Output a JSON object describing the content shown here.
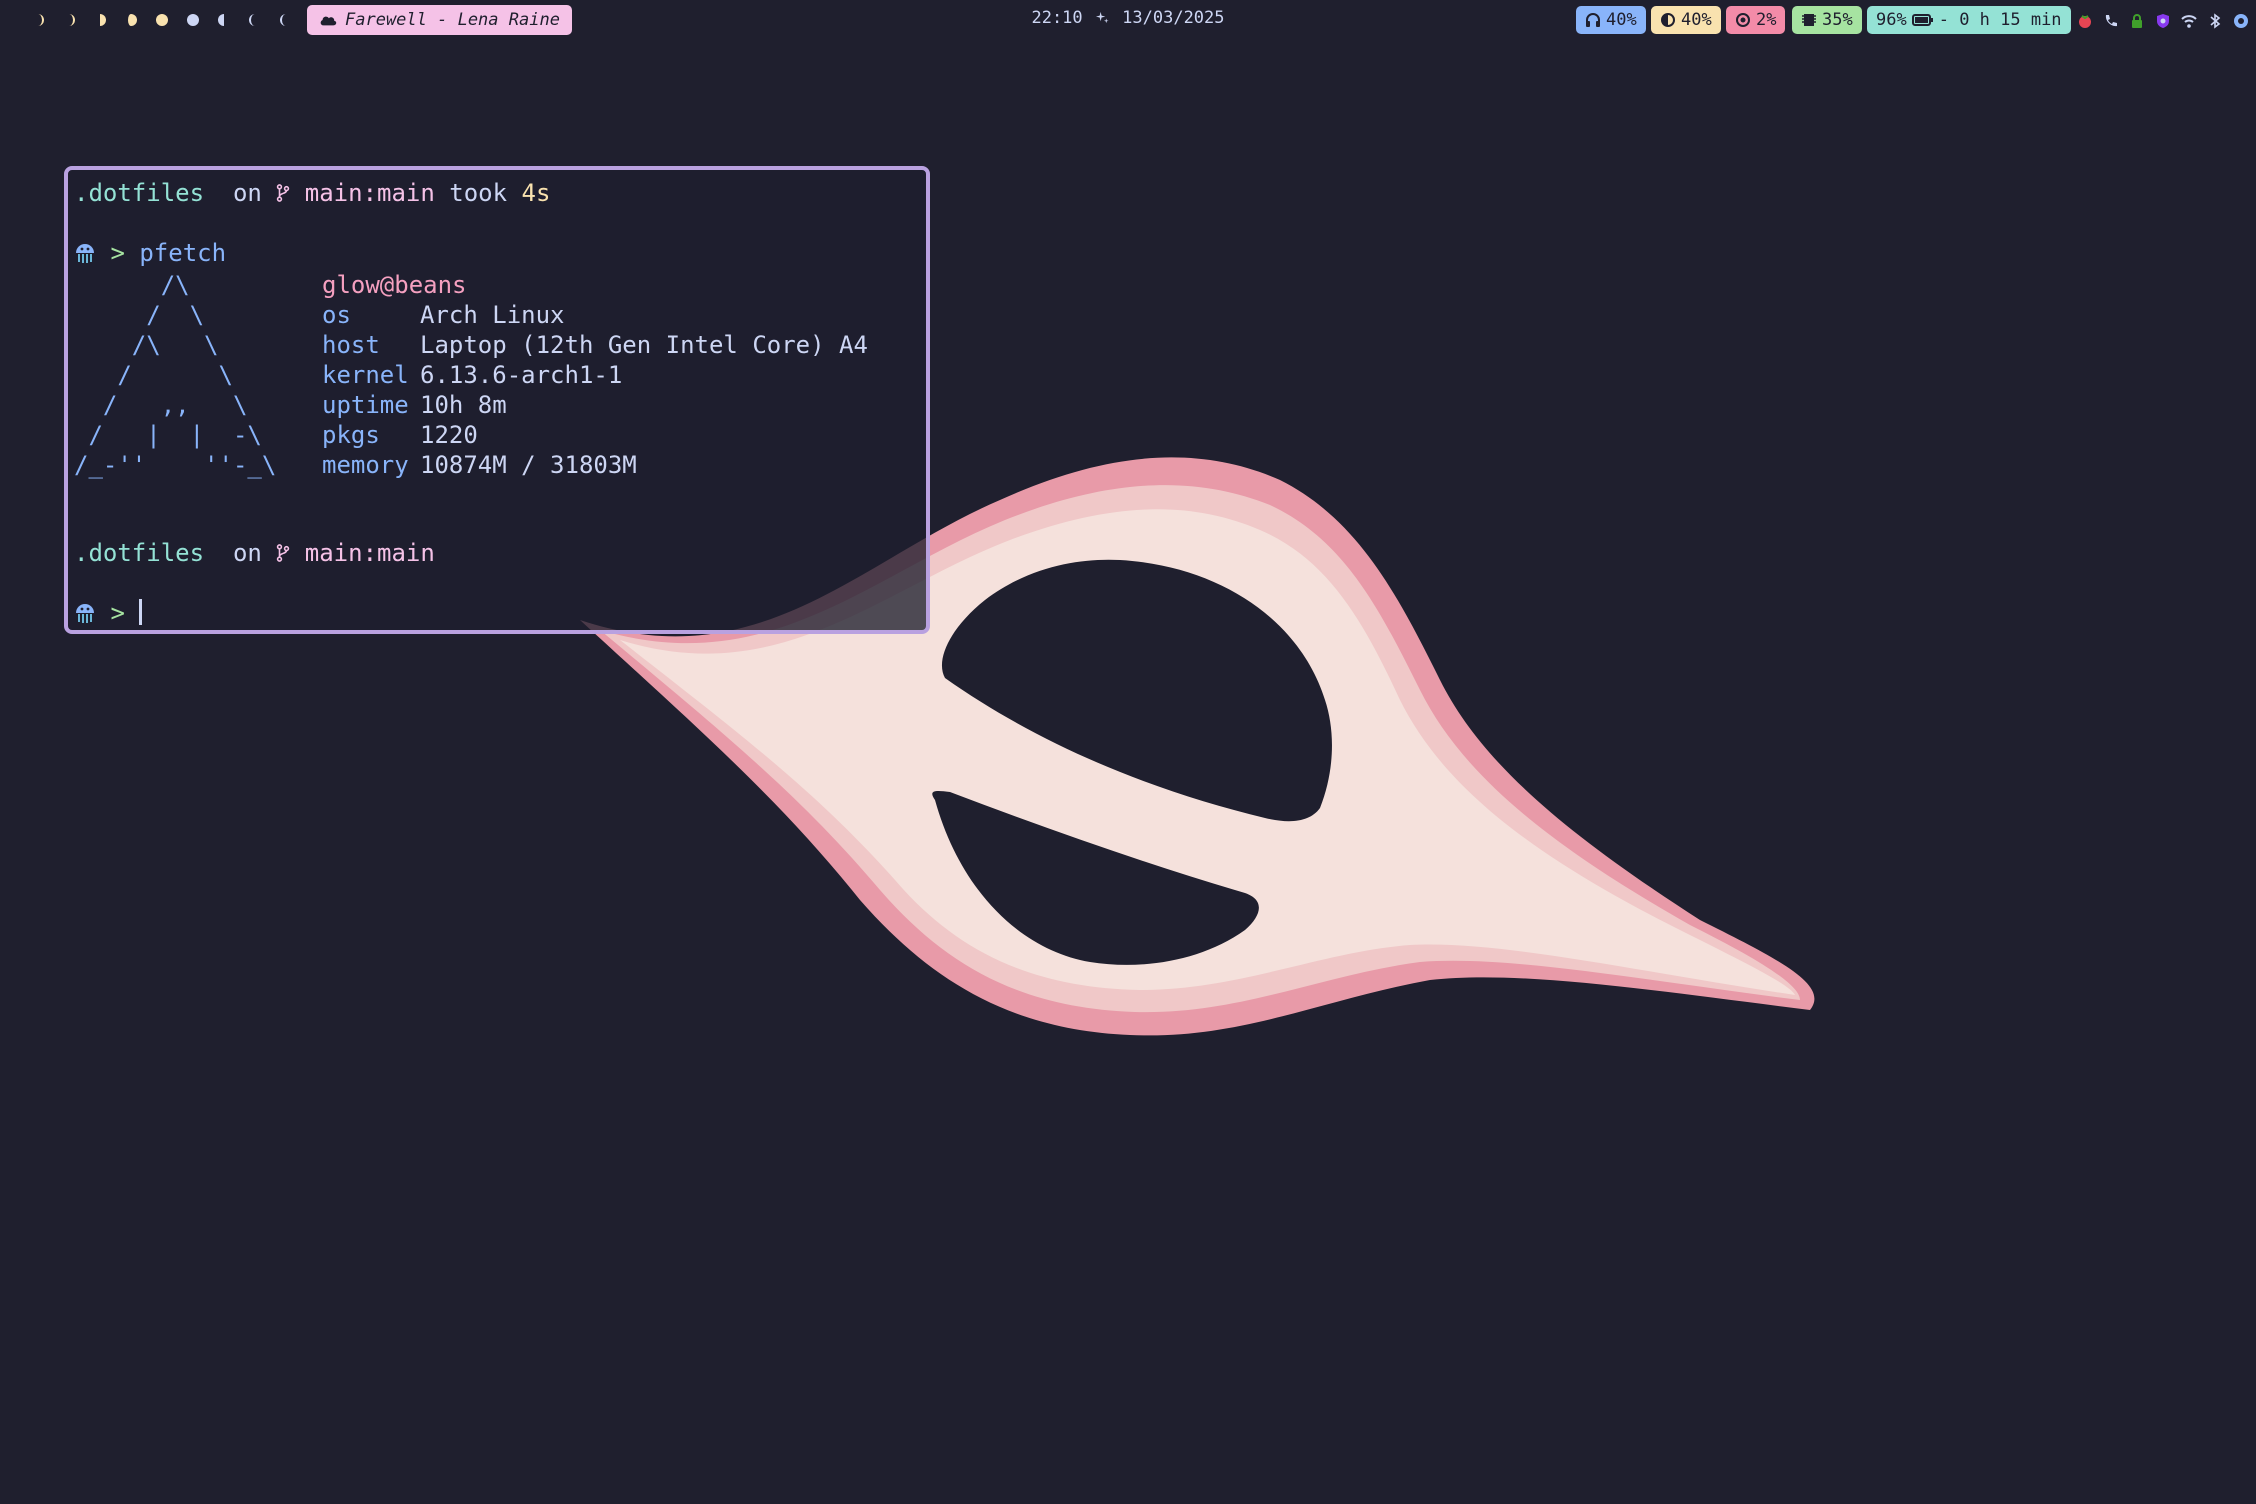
{
  "topbar": {
    "workspaces": [
      {
        "icon": "waxing-crescent-moon-icon",
        "color": "#f9e2af"
      },
      {
        "icon": "waxing-crescent-moon-icon",
        "color": "#f9e2af"
      },
      {
        "icon": "first-quarter-moon-icon",
        "color": "#f9e2af"
      },
      {
        "icon": "waxing-gibbous-moon-icon",
        "color": "#f9e2af"
      },
      {
        "icon": "full-moon-icon",
        "color": "#f9e2af"
      },
      {
        "icon": "full-moon-icon",
        "color": "#cdd6f4"
      },
      {
        "icon": "last-quarter-moon-icon",
        "color": "#cdd6f4"
      },
      {
        "icon": "waning-crescent-moon-icon",
        "color": "#cdd6f4"
      },
      {
        "icon": "waning-crescent-moon-icon",
        "color": "#cdd6f4"
      }
    ],
    "media": {
      "icon": "cloud-icon",
      "text": "Farewell - Lena Raine"
    },
    "clock": {
      "time": "22:10",
      "separator_icon": "sparkles-icon",
      "date": "13/03/2025"
    },
    "indicators": {
      "volume": {
        "icon": "headphones-icon",
        "text": "40%",
        "color": "#89b4fa"
      },
      "brightness": {
        "icon": "brightness-icon",
        "text": "40%",
        "color": "#f9e2af"
      },
      "cpu": {
        "icon": "cpu-icon",
        "text": "2%",
        "color": "#f38ba8"
      },
      "memory": {
        "icon": "memory-chip-icon",
        "text": "35%",
        "color": "#a6e3a1"
      },
      "battery": {
        "text_before": "96%",
        "icon": "battery-icon",
        "text_after": "- 0 h 15 min",
        "color": "#94e2d5"
      }
    },
    "tray": [
      "tomato-icon",
      "phone-icon",
      "lock-icon",
      "vpn-icon",
      "wifi-icon",
      "bluetooth-icon",
      "notification-icon"
    ]
  },
  "terminal": {
    "prompt1": {
      "dir": ".dotfiles",
      "on": "on",
      "branch_icon": "git-branch-icon",
      "branch": "main:main",
      "took": "took",
      "duration": "4s"
    },
    "command": {
      "icon": "jellyfish-icon",
      "arrow": ">",
      "cmd": "pfetch"
    },
    "logo": "      /\\\n     /  \\\n    /\\   \\\n   /      \\\n  /   ,,   \\\n /   |  |  -\\\n/_-''    ''-_\\",
    "userhost": "glow@beans",
    "info": [
      {
        "key": "os",
        "value": "Arch Linux"
      },
      {
        "key": "host",
        "value": "Laptop (12th Gen Intel Core) A4"
      },
      {
        "key": "kernel",
        "value": "6.13.6-arch1-1"
      },
      {
        "key": "uptime",
        "value": "10h 8m"
      },
      {
        "key": "pkgs",
        "value": "1220"
      },
      {
        "key": "memory",
        "value": "10874M / 31803M"
      }
    ],
    "prompt2": {
      "dir": ".dotfiles",
      "on": "on",
      "branch_icon": "git-branch-icon",
      "branch": "main:main"
    },
    "input": {
      "icon": "jellyfish-icon",
      "arrow": ">",
      "value": ""
    }
  },
  "colors": {
    "background": "#1f1f2e",
    "terminal_border": "#b9a1e0",
    "blob_outer": "#e89aa8",
    "blob_mid": "#f0c8c8",
    "blob_inner": "#f5e1dc"
  }
}
